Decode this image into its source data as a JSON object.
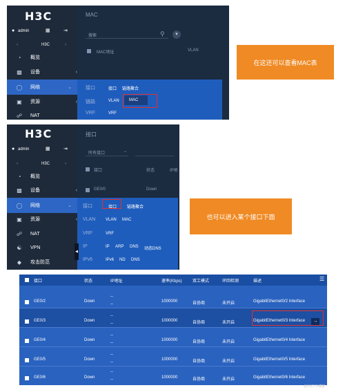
{
  "panel1": {
    "logo": "H3C",
    "user": "admin",
    "header": "MAC",
    "nav_label": "H3C",
    "search_placeholder": "搜索",
    "col_mac": "MAC地址",
    "col_vlan": "VLAN",
    "nav": [
      {
        "label": "概览"
      },
      {
        "label": "设备"
      },
      {
        "label": "网络"
      },
      {
        "label": "资源"
      },
      {
        "label": "NAT"
      }
    ],
    "submenu": {
      "row1": [
        "接口",
        "接口",
        "链路聚合"
      ],
      "row2": [
        "链路",
        "VLAN",
        "MAC"
      ],
      "row3": [
        "VRF",
        "VRF"
      ]
    }
  },
  "callout1": "在这还可以查看MAC表",
  "panel2": {
    "logo": "H3C",
    "user": "admin",
    "header": "接口",
    "nav_label": "H3C",
    "filter": "所有接口",
    "col_iface": "接口",
    "col_status": "状态",
    "col_ip": "IP地",
    "row_iface": "GE0/0",
    "row_status": "Down",
    "nav": [
      {
        "label": "概览"
      },
      {
        "label": "设备"
      },
      {
        "label": "网络"
      },
      {
        "label": "资源"
      },
      {
        "label": "NAT"
      },
      {
        "label": "VPN"
      },
      {
        "label": "攻击防范"
      }
    ],
    "submenu": {
      "row1": [
        "接口",
        "接口",
        "链路聚合"
      ],
      "row2": [
        "VLAN",
        "VLAN",
        "MAC"
      ],
      "row3": [
        "VRF",
        "VRF"
      ],
      "row4": [
        "IP",
        "IP",
        "ARP",
        "DNS",
        "动态DNS"
      ],
      "row5": [
        "IPv6",
        "IPv6",
        "ND",
        "DNS"
      ]
    }
  },
  "callout2": "也可以进入某个接口下面",
  "table": {
    "headers": [
      "接口",
      "状态",
      "IP地址",
      "速率(Kbps)",
      "双工模式",
      "环回检测",
      "描述"
    ],
    "rows": [
      {
        "iface": "GE0/2",
        "status": "Down",
        "ip": "--",
        "speed": "1000000",
        "duplex": "自协商",
        "loop": "未开启",
        "desc": "GigabitEthernet0/2 Interface"
      },
      {
        "iface": "GE0/3",
        "status": "Down",
        "ip": "--",
        "speed": "1000000",
        "duplex": "自协商",
        "loop": "未开启",
        "desc": "GigabitEthernet0/3 Interface"
      },
      {
        "iface": "GE0/4",
        "status": "Down",
        "ip": "--",
        "speed": "1000000",
        "duplex": "自协商",
        "loop": "未开启",
        "desc": "GigabitEthernet0/4 Interface"
      },
      {
        "iface": "GE0/5",
        "status": "Down",
        "ip": "--",
        "speed": "1000000",
        "duplex": "自协商",
        "loop": "未开启",
        "desc": "GigabitEthernet0/5 Interface"
      },
      {
        "iface": "GE0/6",
        "status": "Down",
        "ip": "--",
        "speed": "1000000",
        "duplex": "自协商",
        "loop": "未开启",
        "desc": "GigabitEthernet0/6 Interface"
      }
    ]
  },
  "watermark": "@51CTO博客"
}
